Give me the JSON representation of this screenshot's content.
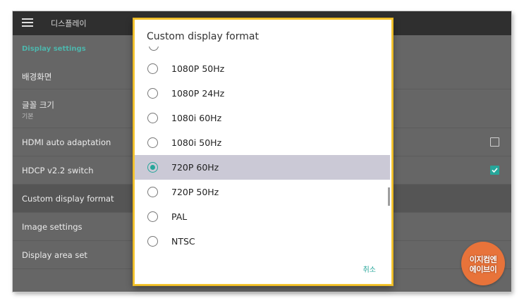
{
  "appbar": {
    "title": "디스플레이",
    "menu_icon": "hamburger-menu-icon"
  },
  "settings": {
    "section_title": "Display settings",
    "items": [
      {
        "label": "배경화면"
      },
      {
        "label": "글꼴 크기",
        "sublabel": "기본"
      },
      {
        "label": "HDMI auto adaptation",
        "checked": false
      },
      {
        "label": "HDCP v2.2 switch",
        "checked": true
      },
      {
        "label": "Custom display format",
        "highlighted": true
      },
      {
        "label": "Image settings"
      },
      {
        "label": "Display area set"
      }
    ]
  },
  "dialog": {
    "title": "Custom display format",
    "options": [
      {
        "label": "1080P 50Hz",
        "selected": false
      },
      {
        "label": "1080P 24Hz",
        "selected": false
      },
      {
        "label": "1080i 60Hz",
        "selected": false
      },
      {
        "label": "1080i 50Hz",
        "selected": false
      },
      {
        "label": "720P 60Hz",
        "selected": true
      },
      {
        "label": "720P 50Hz",
        "selected": false
      },
      {
        "label": "PAL",
        "selected": false
      },
      {
        "label": "NTSC",
        "selected": false
      }
    ],
    "cancel_label": "취소"
  },
  "watermark": {
    "line1": "이지컴엔",
    "line2": "에이브이"
  },
  "colors": {
    "accent": "#26a69a",
    "dialog_border": "#f4c430",
    "selected_row": "#cbc9d6",
    "badge": "#e8733a"
  }
}
